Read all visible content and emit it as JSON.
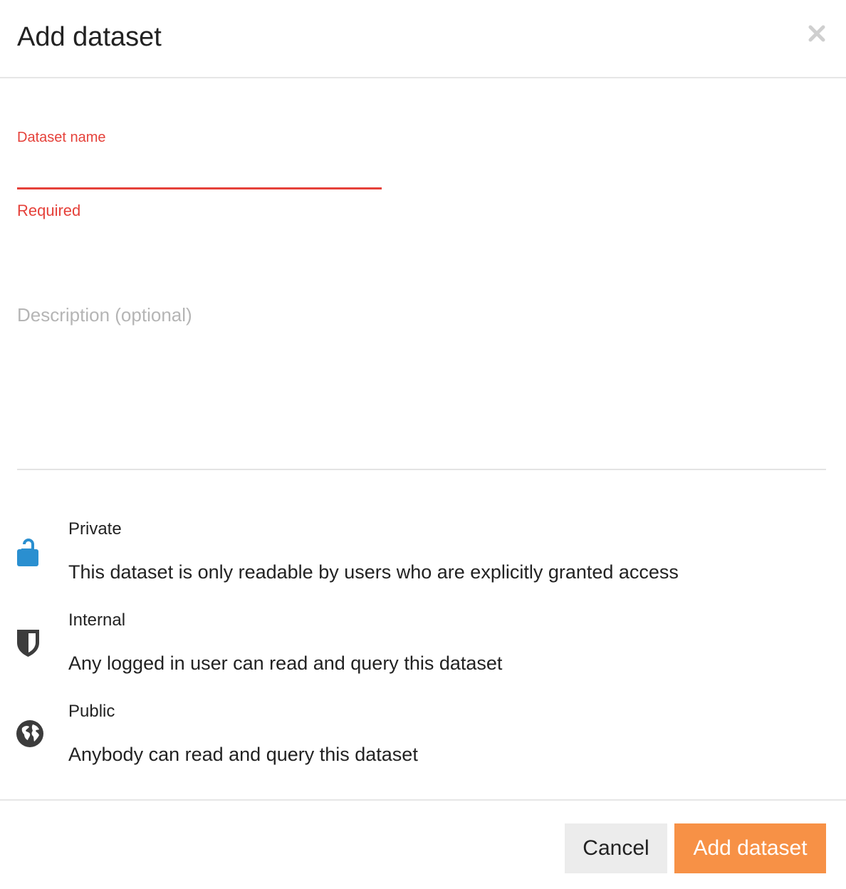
{
  "dialog": {
    "title": "Add dataset",
    "close_icon": "close-icon"
  },
  "form": {
    "name_label": "Dataset name",
    "name_value": "",
    "name_error": "Required",
    "description_value": "",
    "description_placeholder": "Description (optional)"
  },
  "visibility_options": [
    {
      "icon": "lock-icon",
      "title": "Private",
      "description": "This dataset is only readable by users who are explicitly granted access"
    },
    {
      "icon": "shield-icon",
      "title": "Internal",
      "description": "Any logged in user can read and query this dataset"
    },
    {
      "icon": "globe-icon",
      "title": "Public",
      "description": "Anybody can read and query this dataset"
    }
  ],
  "footer": {
    "cancel_label": "Cancel",
    "submit_label": "Add dataset"
  },
  "colors": {
    "error": "#e5413a",
    "accent": "#f79146",
    "lock_icon": "#2a8fd0",
    "icon_dark": "#3c3c3c",
    "close_icon": "#cfcfcf",
    "cancel_bg": "#ececec"
  }
}
